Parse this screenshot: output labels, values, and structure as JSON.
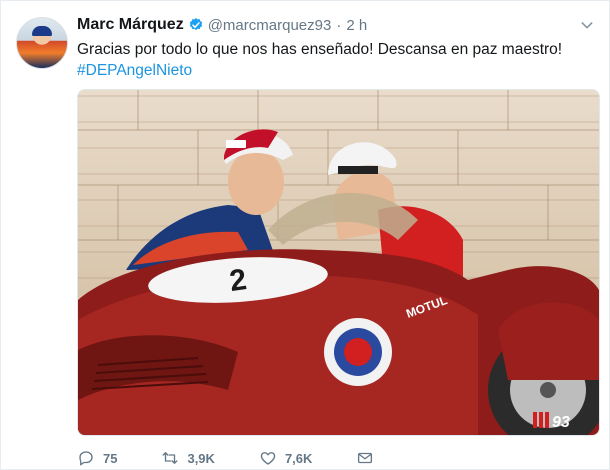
{
  "tweet": {
    "name": "Marc Márquez",
    "handle": "@marcmarquez93",
    "separator": "·",
    "time": "2 h",
    "text": "Gracias por todo lo que nos has enseñado! Descansa en paz maestro!",
    "hashtag": "#DEPAngelNieto",
    "photo": {
      "car_number": "2",
      "car_lettering": "MOTUL",
      "watermark": "93"
    }
  },
  "actions": {
    "replies": "75",
    "retweets": "3,9K",
    "likes": "7,6K"
  },
  "icons": [
    "verified-badge-icon",
    "chevron-down-icon",
    "reply-icon",
    "retweet-icon",
    "heart-icon",
    "envelope-icon"
  ],
  "colors": {
    "link": "#1b95e0",
    "text": "#14171a",
    "muted": "#657786",
    "verified": "#1da1f2"
  }
}
